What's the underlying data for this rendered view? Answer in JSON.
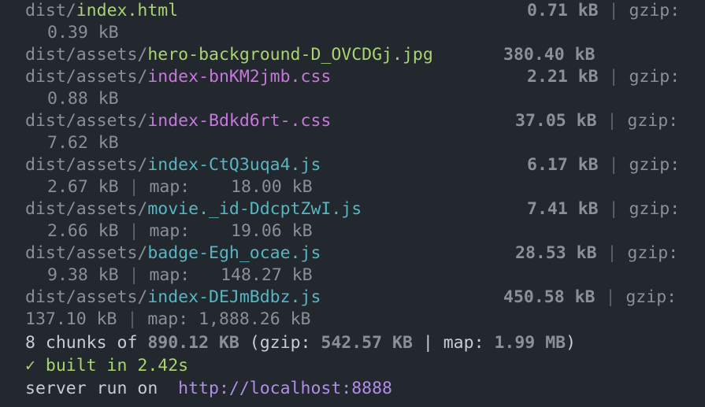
{
  "files": [
    {
      "dir": "dist/",
      "name": "index.html",
      "size": "0.71 kB",
      "gzip_label": "gzip:",
      "gzip": "0.39 kB"
    },
    {
      "dir": "dist/assets/",
      "name": "hero-background-D_OVCDGj.jpg",
      "size": "380.40 kB"
    },
    {
      "dir": "dist/assets/",
      "name": "index-bnKM2jmb.css",
      "size": "2.21 kB",
      "gzip_label": "gzip:",
      "gzip": "0.88 kB"
    },
    {
      "dir": "dist/assets/",
      "name": "index-Bdkd6rt-.css",
      "size": "37.05 kB",
      "gzip_label": "gzip:",
      "gzip": "7.62 kB"
    },
    {
      "dir": "dist/assets/",
      "name": "index-CtQ3uqa4.js",
      "size": "6.17 kB",
      "gzip_label": "gzip:",
      "gzip": "2.67 kB",
      "map_label": "map:",
      "map": "18.00 kB"
    },
    {
      "dir": "dist/assets/",
      "name": "movie._id-DdcptZwI.js",
      "size": "7.41 kB",
      "gzip_label": "gzip:",
      "gzip": "2.66 kB",
      "map_label": "map:",
      "map": "19.06 kB"
    },
    {
      "dir": "dist/assets/",
      "name": "badge-Egh_ocae.js",
      "size": "28.53 kB",
      "gzip_label": "gzip:",
      "gzip": "9.38 kB",
      "map_label": "map:",
      "map": "148.27 kB"
    },
    {
      "dir": "dist/assets/",
      "name": "index-DEJmBdbz.js",
      "size": "450.58 kB",
      "gzip_label": "gzip:",
      "gzip": "137.10 kB",
      "map_label": "map:",
      "map": "1,888.26 kB"
    }
  ],
  "summary": {
    "prefix": "8 chunks of ",
    "total": "890.12 KB",
    "gzip_prefix": " (gzip: ",
    "gzip": "542.57 KB",
    "map_prefix": " | map: ",
    "map": "1.99 MB",
    "suffix": ")"
  },
  "built": {
    "check": "✓",
    "text": " built in 2.42s"
  },
  "server": {
    "text": "server run on  ",
    "url": "http://localhost:8888"
  },
  "separator": "|",
  "colors": {
    "background": "#23272e",
    "html": "#a9d46f",
    "css": "#c678dd",
    "js": "#56b6c2",
    "url": "#b08ee8",
    "success": "#a9d46f"
  }
}
